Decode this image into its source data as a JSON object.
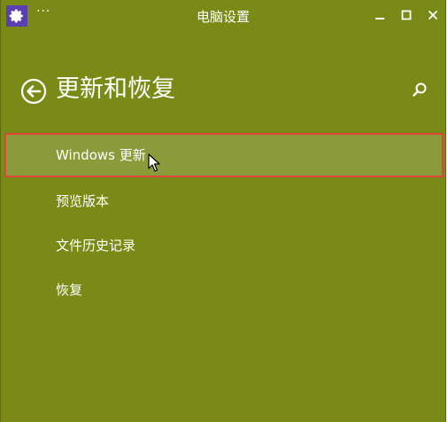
{
  "window": {
    "title": "电脑设置",
    "menu_glyph": "···"
  },
  "colors": {
    "background": "#7a8a16",
    "selected_background": "#8b9b3a",
    "highlight_border": "#e0453a",
    "app_icon": "#5b3fb0",
    "text": "#ffffff"
  },
  "header": {
    "title": "更新和恢复"
  },
  "icons": {
    "app": "gear-icon",
    "back": "back-arrow-circle-icon",
    "search": "search-icon",
    "minimize": "minimize-icon",
    "maximize": "maximize-icon",
    "close": "close-icon",
    "cursor": "mouse-pointer-icon"
  },
  "nav": {
    "items": [
      {
        "label": "Windows 更新",
        "selected": true
      },
      {
        "label": "预览版本",
        "selected": false
      },
      {
        "label": "文件历史记录",
        "selected": false
      },
      {
        "label": "恢复",
        "selected": false
      }
    ]
  }
}
